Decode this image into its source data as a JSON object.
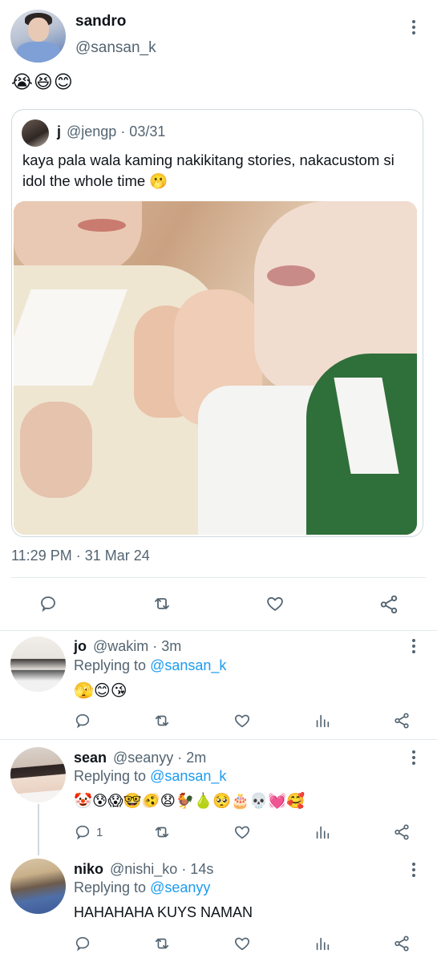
{
  "main_tweet": {
    "author_name": "sandro",
    "author_handle": "@sansan_k",
    "text_emojis": "😭😆😊",
    "quote": {
      "author_name": "j",
      "meta": "@jengp · 03/31",
      "text": "kaya pala wala kaming nakikitang stories, nakacustom si idol the whole time 🫢"
    },
    "timestamp": "11:29 PM · 31 Mar 24",
    "actions": [
      "reply-icon",
      "retweet-icon",
      "like-icon",
      "share-icon"
    ]
  },
  "replies": [
    {
      "name": "jo",
      "handle_time": "@wakim · 3m",
      "replying_label": "Replying to ",
      "replying_to": "@sansan_k",
      "content": "🫣😊😘",
      "reply_count": ""
    },
    {
      "name": "sean",
      "handle_time": "@seanyy · 2m",
      "replying_label": "Replying to ",
      "replying_to": "@sansan_k",
      "content": "🤡😰😱🤓🫨😧🐓🍐🥺🎂💀💓🥰",
      "reply_count": "1"
    },
    {
      "name": "niko",
      "handle_time": "@nishi_ko · 14s",
      "replying_label": "Replying to ",
      "replying_to": "@seanyy",
      "content": "HAHAHAHA KUYS NAMAN",
      "reply_count": ""
    }
  ],
  "colors": {
    "accent": "#1d9bf0",
    "secondary_text": "#536471",
    "primary_text": "#0f1419",
    "border": "#cfd9de"
  }
}
